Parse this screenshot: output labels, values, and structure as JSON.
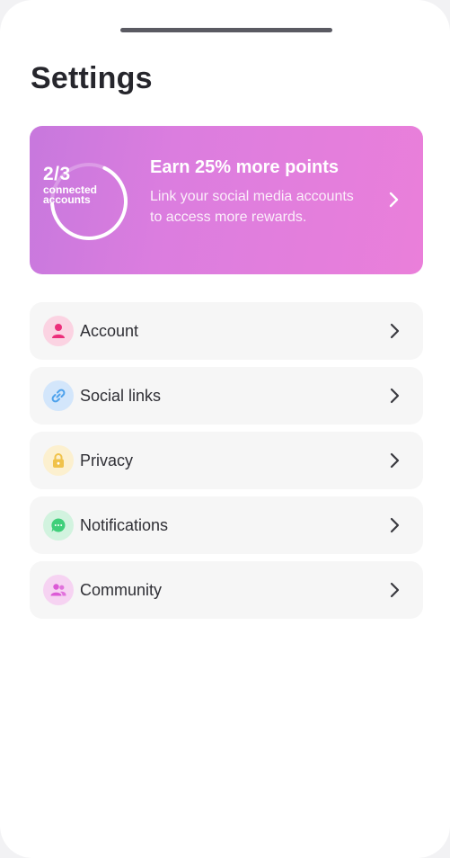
{
  "header": {
    "title": "Settings"
  },
  "promo": {
    "count": "2/3",
    "caption": "connected accounts",
    "connected": 2,
    "total": 3,
    "heading": "Earn 25% more points",
    "text": "Link your social media accounts to access more rewards."
  },
  "settings": {
    "items": [
      {
        "label": "Account",
        "icon": "person-icon",
        "bg": "#fbd3e2",
        "color": "#ec2f7b"
      },
      {
        "label": "Social links",
        "icon": "link-icon",
        "bg": "#d3e6fb",
        "color": "#4ea2ec"
      },
      {
        "label": "Privacy",
        "icon": "lock-icon",
        "bg": "#fcf0cf",
        "color": "#f0c24a"
      },
      {
        "label": "Notifications",
        "icon": "chat-bubble-icon",
        "bg": "#d2f3df",
        "color": "#3fcf7a"
      },
      {
        "label": "Community",
        "icon": "group-icon",
        "bg": "#f6d3f2",
        "color": "#dc5ad6"
      }
    ]
  }
}
